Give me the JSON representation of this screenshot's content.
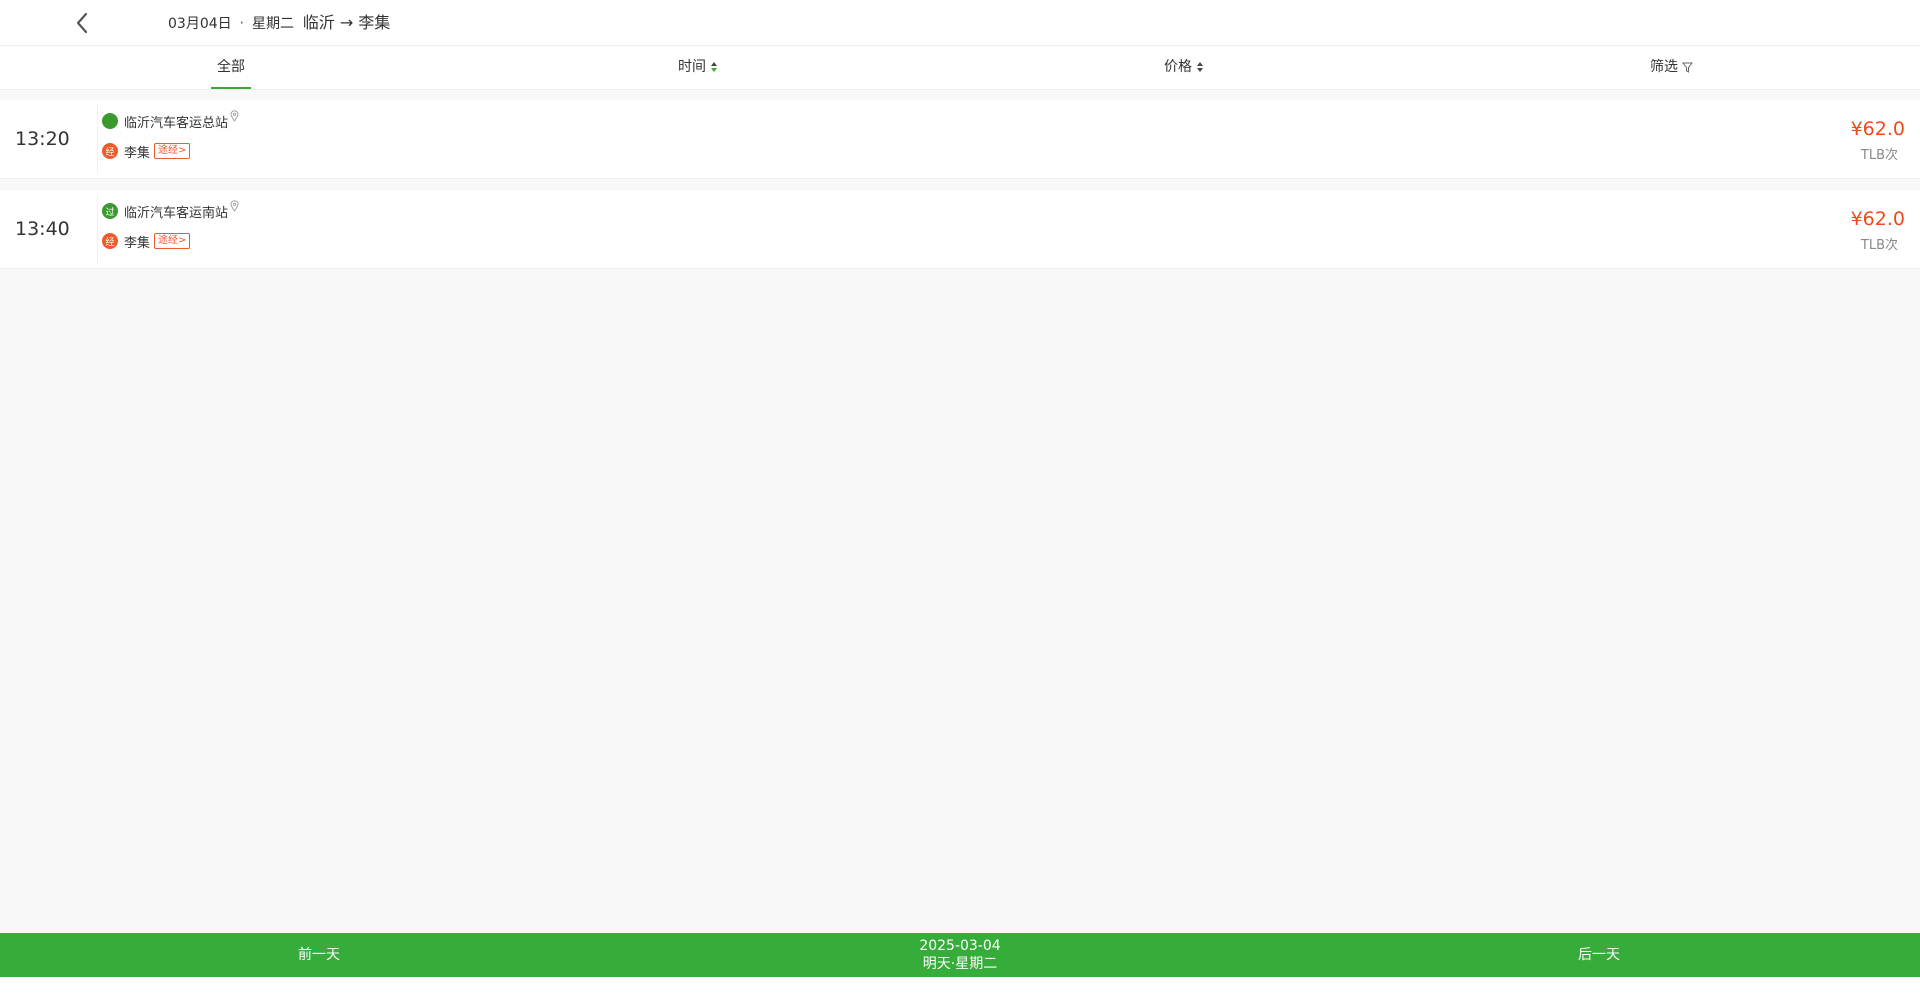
{
  "header": {
    "back_icon": "chevron-left-icon",
    "date": "03月04日",
    "dot": "·",
    "weekday": "星期二",
    "route": "临沂 → 李集"
  },
  "tabs": [
    {
      "label": "全部",
      "active": true
    },
    {
      "label": "时间",
      "icon": "sort-icon"
    },
    {
      "label": "价格",
      "icon": "sort-icon"
    },
    {
      "label": "筛选",
      "icon": "filter-icon"
    }
  ],
  "trips": [
    {
      "time": "13:20",
      "from_badge": "",
      "from_station": "临沂汽车客运总站",
      "via_badge": "经",
      "to_station": "李集",
      "route_tag": "途经>",
      "price": "¥62.0",
      "note": "TLB次"
    },
    {
      "time": "13:40",
      "from_badge": "过",
      "from_station": "临沂汽车客运南站",
      "via_badge": "经",
      "to_station": "李集",
      "route_tag": "途经>",
      "price": "¥62.0",
      "note": "TLB次"
    }
  ],
  "bottom_bar": {
    "prev_label": "前一天",
    "date": "2025-03-04",
    "day_label": "明天·星期二",
    "next_label": "后一天"
  },
  "colors": {
    "accent_green": "#36ad3b",
    "price_red": "#f04a1a",
    "badge_red": "#f05a2a"
  }
}
